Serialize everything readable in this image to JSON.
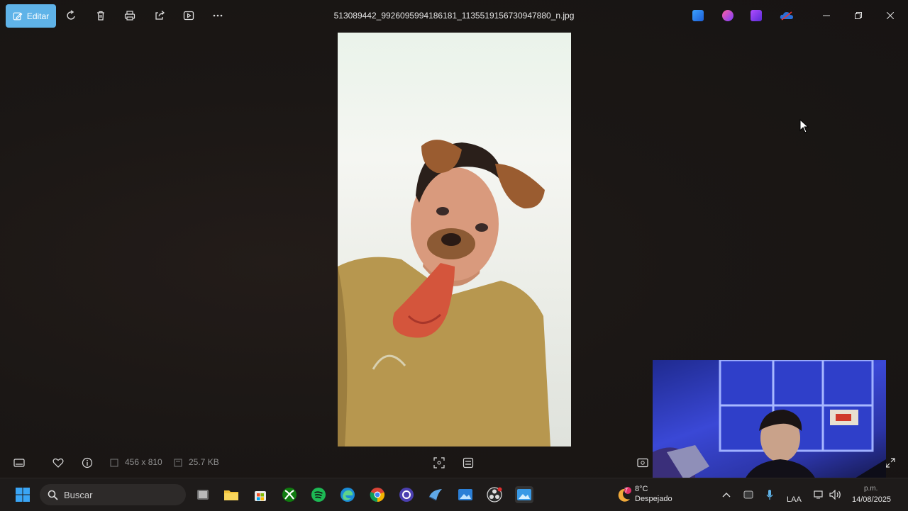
{
  "window": {
    "title": "513089442_9926095994186181_1135519156730947880_n.jpg"
  },
  "toolbar": {
    "edit_label": "Editar",
    "icons": [
      "edit-icon",
      "rotate-icon",
      "delete-icon",
      "print-icon",
      "share-icon",
      "slideshow-icon",
      "more-icon"
    ]
  },
  "app_icons": [
    "designer-icon",
    "clipchamp-icon",
    "video-editor-icon",
    "onedrive-icon"
  ],
  "window_controls": [
    "minimize-icon",
    "restore-icon",
    "close-icon"
  ],
  "status_bar": {
    "dimensions": "456 x 810",
    "file_size": "25.7 KB"
  },
  "taskbar": {
    "search_placeholder": "Buscar",
    "weather_temp": "8°C",
    "weather_desc": "Despejado",
    "weather_badge": "7",
    "language": "LAA",
    "date": "14/08/2025",
    "time_partial": "p.m."
  },
  "colors": {
    "accent": "#5fb3e8",
    "background": "#1b1715",
    "taskbar": "#1e1b1a"
  }
}
